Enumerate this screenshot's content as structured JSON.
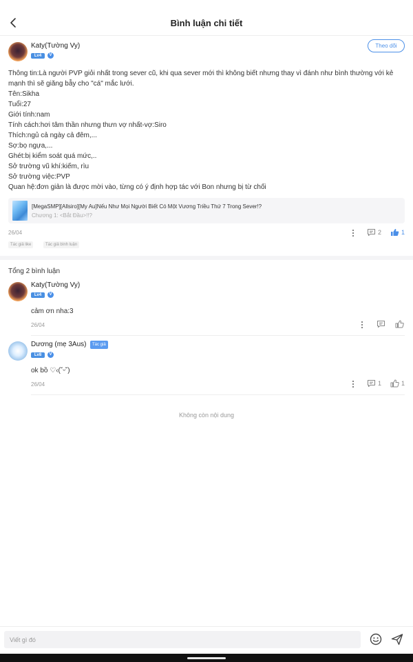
{
  "header": {
    "title": "Bình luận chi tiết"
  },
  "post": {
    "author": "Katy(Tường Vy)",
    "level_badge": "Lv4",
    "verified_badge": "V",
    "follow_label": "Theo dõi",
    "lines": [
      "Thông tin:Là người PVP giỏi nhất trong sever cũ, khi qua sever mới thì không biết nhưng thay vì đánh như bình thường với kẻ",
      "mạnh thì sẽ giăng bẫy cho \"cá\" mắc lưới.",
      "Tên:Sikha",
      "Tuổi:27",
      "Giới tính:nam",
      "Tính cách:hơi tâm thần nhưng thưn vợ nhất-vợ:Siro",
      "Thích:ngủ cả ngày cả đêm,...",
      "Sợ:bọ ngựa,...",
      "Ghét:bị kiểm soát quá mức,..",
      "Sở trường vũ khí:kiếm, rìu",
      "Sở trường việc:PVP",
      "Quan hệ:đơn giản là được mời vào, từng có ý định hợp tác với Bon nhưng bị từ chối"
    ],
    "book_title": "[MegaSMP][Allsiro][My Au]Nếu Như Mọi Người Biết Có Một Vương Triều Thứ 7 Trong Sever!?",
    "book_chapter": "Chương 1: <Bắt Đầu>!!?",
    "date": "26/04",
    "comment_count": "2",
    "like_count": "1",
    "tags": [
      "Tác giả like",
      "Tác giả bình luận"
    ]
  },
  "comments_total": "Tổng 2 bình luận",
  "comments": [
    {
      "author": "Katy(Tường Vy)",
      "level_badge": "Lv4",
      "verified_badge": "V",
      "text": "cảm ơn nha:3",
      "date": "26/04",
      "reply_count": "",
      "like_count": ""
    },
    {
      "author": "Dương (mẹ 3Aus)",
      "author_tag": "Tác giả",
      "level_badge": "Lv8",
      "verified_badge": "V",
      "text": "ok bồ ♡‹(˘ᵕ˘)",
      "date": "26/04",
      "reply_count": "1",
      "like_count": "1"
    }
  ],
  "empty_note": "Không còn nội dung",
  "composer": {
    "placeholder": "Viết gì đó"
  },
  "colors": {
    "accent": "#4a8fe8",
    "badge_blue": "#4a90e2"
  },
  "icons": [
    "back-arrow-icon",
    "more-vertical-icon",
    "comment-icon",
    "thumb-up-icon",
    "emoji-icon",
    "send-icon"
  ]
}
